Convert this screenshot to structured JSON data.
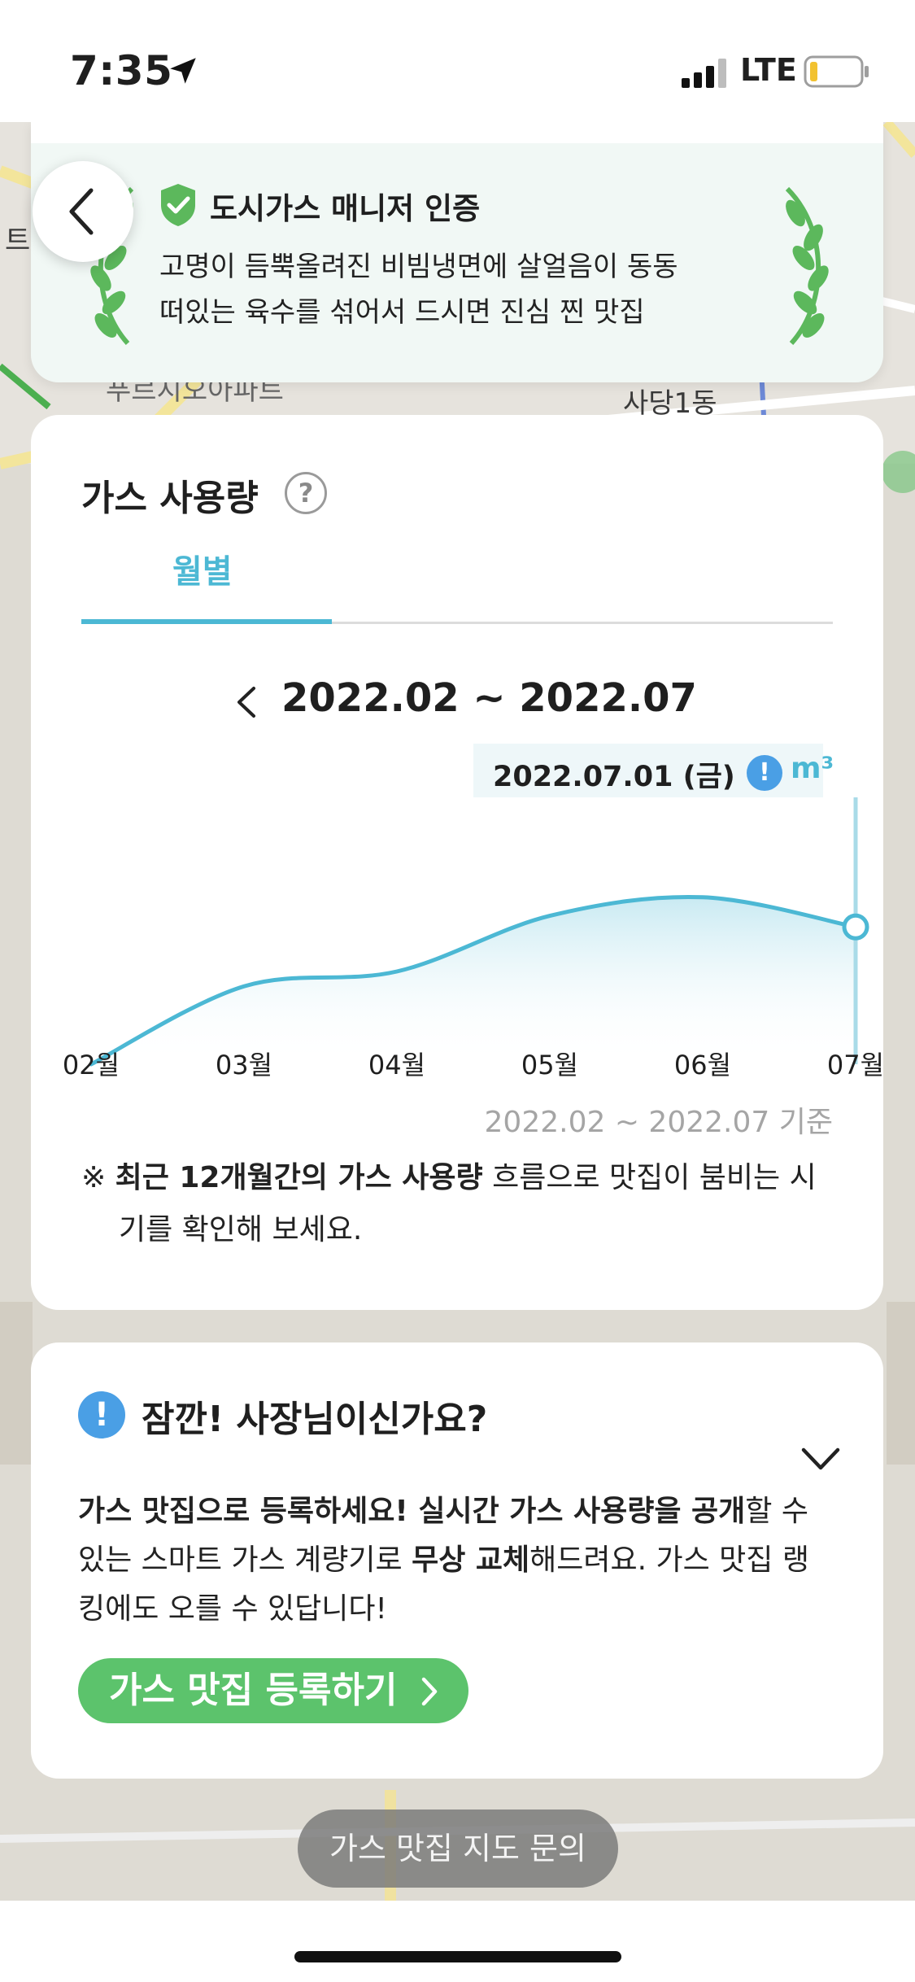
{
  "status_bar": {
    "time": "7:35",
    "network": "LTE",
    "icons": [
      "location-arrow-icon",
      "cellular-signal-icon",
      "battery-low-icon"
    ]
  },
  "map": {
    "labels": [
      "트",
      "푸르지오아파트",
      "사당1동"
    ]
  },
  "certification": {
    "title": "도시가스 매니저 인증",
    "description_line1": "고명이 듬뿍올려진 비빔냉면에 살얼음이 동동",
    "description_line2": "떠있는 육수를 섞어서 드시면 진심 찐 맛집",
    "accent_color": "#5cb85c"
  },
  "gas_usage": {
    "title": "가스 사용량",
    "help_symbol": "?",
    "tab_label": "월별",
    "range_label": "2022.02 ~ 2022.07",
    "tooltip": {
      "date": "2022.07.01 (금)",
      "info_symbol": "!",
      "unit": "m³"
    },
    "footnote": "2022.02 ~ 2022.07 기준",
    "note_prefix": "※ ",
    "note_bold": "최근 12개월간의 가스 사용량",
    "note_rest_line1": "  흐름으로 맛집이 붐비는 시",
    "note_line2": "기를 확인해 보세요.",
    "accent_color": "#4cb8d4"
  },
  "chart_data": {
    "type": "area",
    "categories": [
      "02월",
      "03월",
      "04월",
      "05월",
      "06월",
      "07월"
    ],
    "values": [
      0.0,
      0.42,
      0.5,
      0.8,
      0.9,
      0.74
    ],
    "highlighted_category": "07월",
    "ylim": [
      0,
      1
    ]
  },
  "owner": {
    "alert_symbol": "!",
    "title": "잠깐! 사장님이신가요?",
    "desc_bold1": "가스 맛집으로 등록하세요! 실시간 가스 사용량을 공개",
    "desc_text1": "할 수",
    "desc_text2": "있는 스마트 가스 계량기로 ",
    "desc_bold2": "무상 교체",
    "desc_text3": "해드려요. 가스 맛집 랭",
    "desc_text4": "킹에도 오를 수 있답니다!",
    "register_button": "가스 맛집 등록하기",
    "button_color": "#5cc36c"
  },
  "map_inquiry_button": "가스 맛집 지도 문의"
}
